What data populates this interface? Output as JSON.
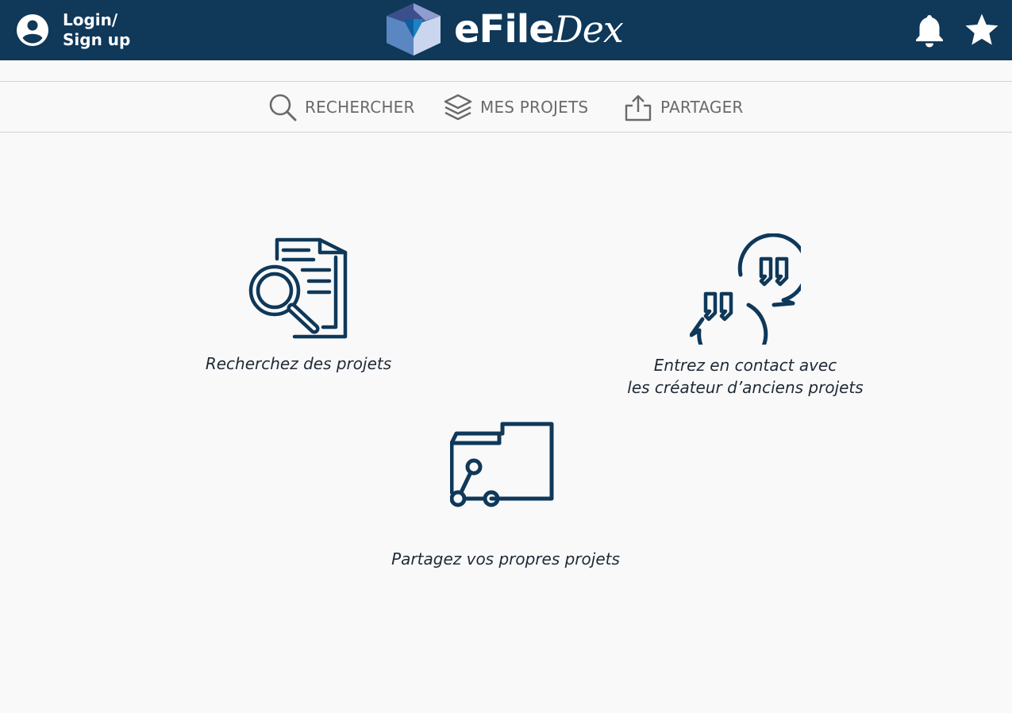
{
  "header": {
    "login_line1": "Login/",
    "login_line2": "Sign up",
    "logo_text_main": "eFile",
    "logo_text_script": "Dex",
    "icons": [
      "account-circle-icon",
      "bell-icon",
      "star-icon"
    ]
  },
  "nav": {
    "items": [
      {
        "label": "RECHERCHER",
        "icon": "search-icon"
      },
      {
        "label": "MES PROJETS",
        "icon": "layers-icon"
      },
      {
        "label": "PARTAGER",
        "icon": "upload-icon"
      }
    ]
  },
  "features": [
    {
      "caption_line1": "Recherchez des projets",
      "icon": "document-search-icon"
    },
    {
      "caption_line1": "Entrez en contact avec",
      "caption_line2": "les créateur d’anciens projets",
      "icon": "quote-bubbles-icon"
    },
    {
      "caption_line1": "Partagez vos propres projets",
      "icon": "shared-folder-icon"
    }
  ],
  "colors": {
    "header_bg": "#0f3859",
    "icon_navy": "#0f3859",
    "nav_text": "#6a6a6a",
    "page_bg": "#f9f9fa"
  }
}
